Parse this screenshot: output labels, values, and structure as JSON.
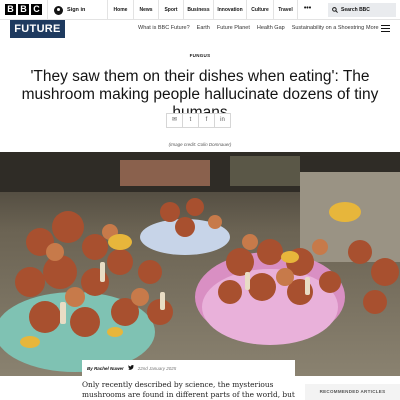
{
  "topbar": {
    "logo_letters": [
      "B",
      "B",
      "C"
    ],
    "signin_label": "Sign in",
    "nav": [
      "Home",
      "News",
      "Sport",
      "Business",
      "Innovation",
      "Culture",
      "Travel"
    ],
    "more_label": "•••",
    "search_label": "Search BBC"
  },
  "site": {
    "logo": "FUTURE",
    "nav": [
      "What is BBC Future?",
      "Earth",
      "Future Planet",
      "Health Gap",
      "Sustainability on a Shoestring"
    ],
    "more_label": "More"
  },
  "article": {
    "category": "FUNGUS",
    "headline": "'They saw them on their dishes when eating': The mushroom making people hallucinate dozens of tiny humans",
    "share": [
      "✉",
      "t",
      "f",
      "in"
    ],
    "image_credit": "(Image credit: Colin Domnauer)",
    "author": "By Rachel Nuwer",
    "date": "22nd January 2025",
    "body": "Only recently described by science, the mysterious mushrooms are found in different parts of the world, but"
  },
  "related": {
    "label": "RECOMMENDED ARTICLES"
  }
}
